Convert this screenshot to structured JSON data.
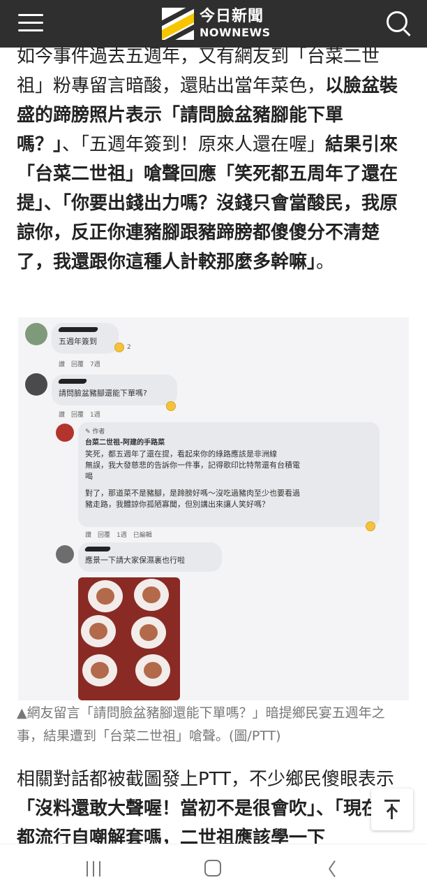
{
  "header": {
    "logo_cn": "今日新聞",
    "logo_en": "NOWNEWS"
  },
  "icons": {
    "menu": "hamburger-menu-icon",
    "search": "search-icon",
    "scroll_top": "arrow-up-icon",
    "nav_recent": "recent-apps-icon",
    "nav_home": "home-icon",
    "nav_back": "back-icon"
  },
  "article": {
    "p1_a": "如今事件過去五週年，又有網友到「台菜二世祖」粉專留言暗酸，還貼出當年菜色，",
    "p1_b": "以臉盆裝盛的蹄膀照片表示「請問臉盆豬腳能下單嗎？」",
    "p1_c": "、「五週年簽到！原來人還在喔」",
    "p1_d": "結果引來「台菜二世祖」嗆聲回應「笑死都五周年了還在提」",
    "p1_e": "、「你要出錢出力嗎？沒錢只會當酸民，我原諒你，反正你連豬腳跟豬蹄膀都傻傻分不清楚了，我還跟你這種人計較那麼多幹嘛」",
    "p1_f": "。",
    "caption": "▲網友留言「請問臉盆豬腳還能下單嗎？」暗提鄉民宴五週年之事，結果遭到「台菜二世祖」嗆聲。(圖/PTT)",
    "p2_a": "相關對話都被截圖發上PTT，不少鄉民傻眼表示",
    "p2_b": "「沒料還敢大聲喔！當初不是很會吹」、「現在不都流行自嘲解套嗎，二世祖應該學一下"
  },
  "screenshot": {
    "c1_text": "五週年簽到",
    "c1_count": "2",
    "c1_meta": "讚　回覆　7週",
    "c2_text": "請問臉盆豬腳還能下單嗎?",
    "c2_meta": "讚　回覆　1週",
    "c3_badge": "✎ 作者",
    "c3_author": "台菜二世祖-阿建的手路菜",
    "c3_line1": "笑死，都五週年了還在提，看起來你的綠路應該是非洲線",
    "c3_line2": "無誤，我大發慈悲的告訴你一件事，記得歌印比特幣還有台積電",
    "c3_line3": "喝",
    "c3_line4": "對了，那道菜不是豬腳，是蹄膀好嗎～沒吃過豬肉至少也要看過",
    "c3_line5": "豬走路，我體諒你孤陋寡聞，但別講出來讓人笑好嗎？",
    "c3_meta": "讚　回覆　1週　已編輯",
    "c4_text": "應景一下請大家保濕裏也行啦"
  },
  "colors": {
    "header_bg": "#2f2f2f",
    "logo_yellow": "#f7c600",
    "caption_gray": "#777777"
  }
}
